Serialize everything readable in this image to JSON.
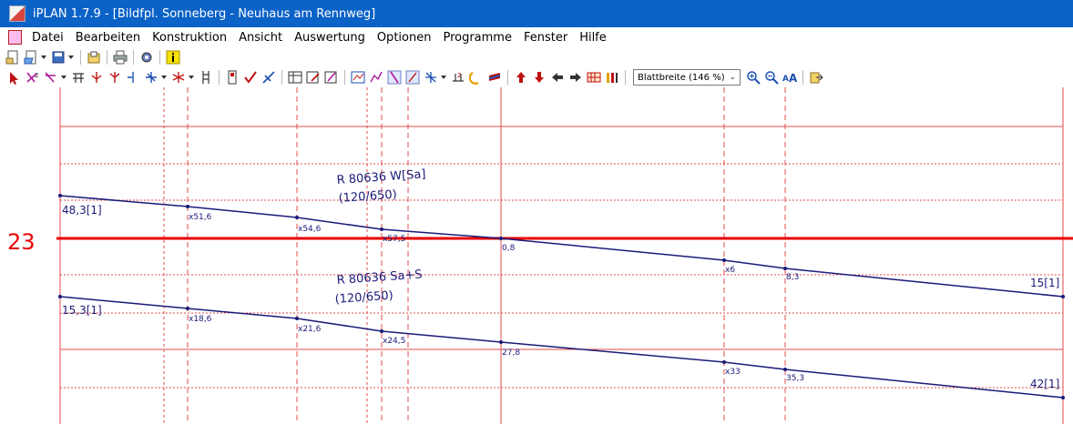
{
  "window": {
    "title": "iPLAN 1.7.9 - [Bildfpl. Sonneberg - Neuhaus am Rennweg]",
    "app_icon": "iplan-app-icon",
    "colors": {
      "titlebar": "#0b62c7",
      "plot_lines": "#1a1a7a",
      "grid": "#e34b4b",
      "hour_line": "#e80000"
    }
  },
  "menu": {
    "items": [
      "Datei",
      "Bearbeiten",
      "Konstruktion",
      "Ansicht",
      "Auswertung",
      "Optionen",
      "Programme",
      "Fenster",
      "Hilfe"
    ]
  },
  "zoom": {
    "value": "Blattbreite (146 %)"
  },
  "chart": {
    "hour_label": "23",
    "trains": [
      {
        "name": "R 80636 W[Sa]",
        "subtitle": "(120/650)",
        "start_label": "48,3[1]",
        "end_label": "15[1]",
        "stops": [
          "x51,6",
          "x54,6",
          "x57,5",
          "0,8",
          "x6",
          "8,3"
        ]
      },
      {
        "name": "R 80636 Sa+S",
        "subtitle": "(120/650)",
        "start_label": "15,3[1]",
        "end_label": "42[1]",
        "stops": [
          "x18,6",
          "x21,6",
          "x24,5",
          "27,8",
          "x33",
          "35,3"
        ]
      }
    ]
  }
}
